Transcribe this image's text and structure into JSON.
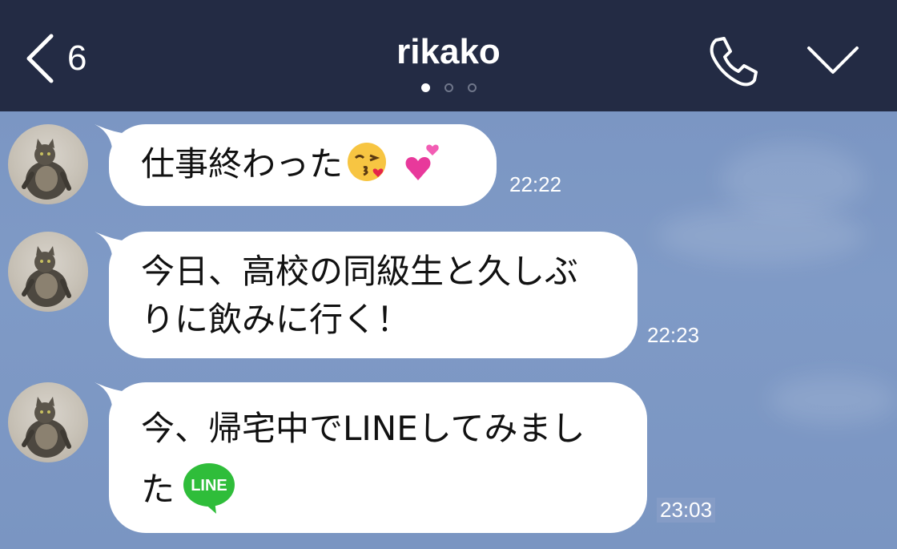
{
  "header": {
    "back_count": "6",
    "title": "rikako",
    "page_dots": 3,
    "active_dot": 0
  },
  "messages": [
    {
      "text": "仕事終わった",
      "emojis": [
        "kissing-face-with-heart",
        "two-hearts"
      ],
      "time": "22:22"
    },
    {
      "text_line1": "今日、高校の同級生と久しぶ",
      "text_line2": "りに飲みに行く！",
      "time": "22:23"
    },
    {
      "text_line1": "今、帰宅中でLINEしてみまし",
      "text_line2": "た",
      "sticker_text": "LINE",
      "time": "23:03"
    }
  ],
  "colors": {
    "header_bg": "#232b44",
    "chat_bg": "#7d98c4",
    "bubble_bg": "#ffffff",
    "line_green": "#2fbd3a"
  }
}
